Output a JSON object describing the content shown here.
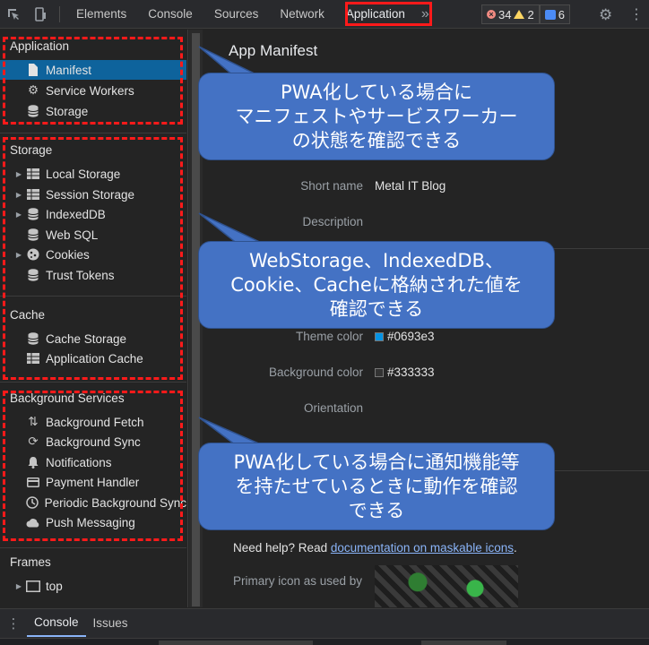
{
  "toolbar": {
    "tabs": [
      "Elements",
      "Console",
      "Sources",
      "Network",
      "Application"
    ],
    "active_tab": "Application",
    "more": "»",
    "errors": "34",
    "warnings": "2",
    "messages": "6"
  },
  "sidebar": {
    "application_title": "Application",
    "application_items": [
      {
        "label": "Manifest",
        "icon": "file-icon"
      },
      {
        "label": "Service Workers",
        "icon": "gear-icon"
      },
      {
        "label": "Storage",
        "icon": "database-icon"
      }
    ],
    "storage_title": "Storage",
    "storage_items": [
      {
        "label": "Local Storage",
        "icon": "table-icon"
      },
      {
        "label": "Session Storage",
        "icon": "table-icon"
      },
      {
        "label": "IndexedDB",
        "icon": "database-icon"
      },
      {
        "label": "Web SQL",
        "icon": "database-icon"
      },
      {
        "label": "Cookies",
        "icon": "cookie-icon"
      },
      {
        "label": "Trust Tokens",
        "icon": "database-icon"
      }
    ],
    "cache_title": "Cache",
    "cache_items": [
      {
        "label": "Cache Storage",
        "icon": "database-icon"
      },
      {
        "label": "Application Cache",
        "icon": "table-icon"
      }
    ],
    "bg_title": "Background Services",
    "bg_items": [
      {
        "label": "Background Fetch",
        "icon": "arrows-updown-icon"
      },
      {
        "label": "Background Sync",
        "icon": "sync-icon"
      },
      {
        "label": "Notifications",
        "icon": "bell-icon"
      },
      {
        "label": "Payment Handler",
        "icon": "card-icon"
      },
      {
        "label": "Periodic Background Sync",
        "icon": "clock-icon"
      },
      {
        "label": "Push Messaging",
        "icon": "cloud-icon"
      }
    ],
    "frames_title": "Frames",
    "frames_items": [
      {
        "label": "top",
        "icon": "frame-icon"
      }
    ]
  },
  "main": {
    "title": "App Manifest",
    "short_name_label": "Short name",
    "short_name_value": "Metal IT Blog",
    "description_label": "Description",
    "theme_color_label": "Theme color",
    "theme_color_value": "#0693e3",
    "background_color_label": "Background color",
    "background_color_value": "#333333",
    "orientation_label": "Orientation",
    "help_prefix": "Need help? Read ",
    "help_link": "documentation on maskable icons",
    "help_suffix": ".",
    "primary_icon_label": "Primary icon as used by"
  },
  "callouts": [
    "PWA化している場合に\nマニフェストやサービスワーカー\nの状態を確認できる",
    "WebStorage、IndexedDB、\nCookie、Cacheに格納された値を\n確認できる",
    "PWA化している場合に通知機能等\nを持たせているときに動作を確認\nできる"
  ],
  "drawer": {
    "tabs": [
      "Console",
      "Issues"
    ],
    "active_tab": "Console"
  },
  "colors": {
    "accent_selected": "#0e639c",
    "callout": "#4472c4",
    "highlight": "#ff1a1a"
  }
}
